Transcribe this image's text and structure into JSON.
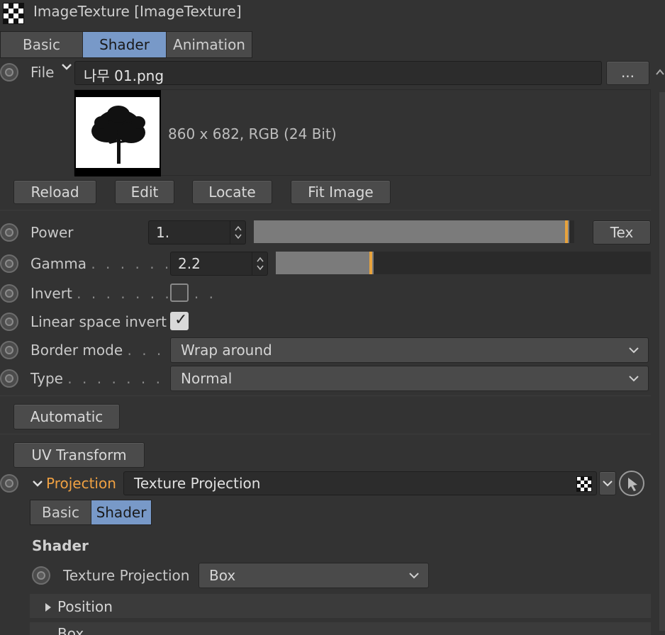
{
  "header": {
    "title": "ImageTexture [ImageTexture]"
  },
  "tabs": [
    {
      "label": "Basic",
      "active": false
    },
    {
      "label": "Shader",
      "active": true
    },
    {
      "label": "Animation",
      "active": false
    }
  ],
  "file": {
    "label": "File",
    "value": "나무 01.png",
    "browse_label": "..."
  },
  "preview": {
    "info": "860 x 682, RGB (24 Bit)"
  },
  "image_buttons": {
    "reload": "Reload",
    "edit": "Edit",
    "locate": "Locate",
    "fit": "Fit Image"
  },
  "power": {
    "label": "Power",
    "value": "1.",
    "tex_label": "Tex",
    "slider_fill": 1.0
  },
  "gamma": {
    "label": "Gamma",
    "dots": ". . . . . . .",
    "value": "2.2",
    "slider_fill": 0.26
  },
  "invert": {
    "label": "Invert",
    "dots": ". . . . . . . . . .",
    "checked": false
  },
  "linear_space_invert": {
    "label": "Linear space invert",
    "checked": true
  },
  "border_mode": {
    "label": "Border mode",
    "dots": ". . . .",
    "value": "Wrap around"
  },
  "type": {
    "label": "Type",
    "dots": ". . . . . . . . . . .",
    "value": "Normal"
  },
  "automatic": {
    "label": "Automatic"
  },
  "uv_transform": {
    "label": "UV Transform"
  },
  "projection": {
    "label": "Projection",
    "value": "Texture Projection",
    "tabs": [
      {
        "label": "Basic",
        "active": false
      },
      {
        "label": "Shader",
        "active": true
      }
    ],
    "section_title": "Shader",
    "texture_projection": {
      "label": "Texture Projection",
      "value": "Box"
    },
    "groups": [
      {
        "label": "Position",
        "expanded": false
      },
      {
        "label": "Box",
        "expanded": true
      }
    ]
  },
  "colors": {
    "accent": "#7899c8",
    "orange": "#e8a33d",
    "projection_label": "#f0a142"
  }
}
